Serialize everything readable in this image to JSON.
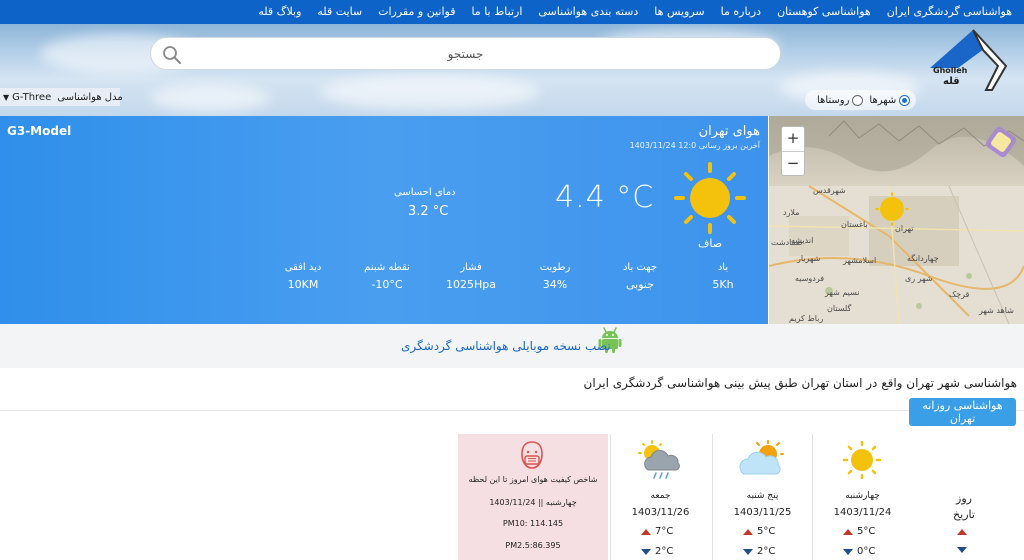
{
  "nav": {
    "items": [
      "هواشناسی گردشگری ایران",
      "هواشناسی کوهستان",
      "درباره ما",
      "سرویس ها",
      "دسته بندی هواشناسی",
      "ارتباط با ما",
      "قوانین و مقررات",
      "سایت قله",
      "وبلاگ قله"
    ]
  },
  "header": {
    "search_placeholder": "جستجو",
    "logo_text": "Gholleh",
    "logo_text_fa": "قله",
    "radio_cities": "شهرها",
    "radio_villages": "روستاها",
    "model_label": "مدل هواشناسی",
    "model_value": "G-Three"
  },
  "weather": {
    "model_name": "G3-Model",
    "city_title": "هوای تهران",
    "updated": "آخرین بروز رسانی 12:0 1403/11/24",
    "temperature": "4.4 °C",
    "condition": "صاف",
    "feels_label": "دمای احساسی",
    "feels_value": "3.2 °C",
    "stats": [
      {
        "label": "باد",
        "value": "5Kh"
      },
      {
        "label": "جهت باد",
        "value": "جنوبی"
      },
      {
        "label": "رطوبت",
        "value": "34%"
      },
      {
        "label": "فشار",
        "value": "1025Hpa"
      },
      {
        "label": "نقطه شبنم",
        "value": "-10°C"
      },
      {
        "label": "دید افقی",
        "value": "10KM"
      }
    ]
  },
  "map": {
    "zoom_in": "+",
    "zoom_out": "−",
    "labels": [
      "شهرقدس",
      "ملارد",
      "باغستان",
      "اندیشه",
      "شهریار",
      "صفادشت",
      "اسلامشهر",
      "تهران",
      "چهاردانگه",
      "شهر ری",
      "فردوسیه",
      "قرچک",
      "نسیم شهر",
      "گلستان",
      "رباط کریم",
      "شاهد شهر"
    ]
  },
  "app": {
    "install_text": "نصب نسخه موبایلی هواشناسی گردشگری"
  },
  "description": "هواشناسی شهر تهران واقع در استان تهران طبق پیش بینی هواشناسی گردشگری ایران",
  "daily_button": "هواشناسی روزانه تهران",
  "forecast": {
    "row_day": "روز",
    "row_date": "تاریخ",
    "days": [
      {
        "day": "چهارشنبه",
        "date": "1403/11/24",
        "hi": "5°C",
        "lo": "0°C",
        "icon": "sun-icon"
      },
      {
        "day": "پنج شنبه",
        "date": "1403/11/25",
        "hi": "5°C",
        "lo": "2°C",
        "icon": "sun-cloud-icon"
      },
      {
        "day": "جمعه",
        "date": "1403/11/26",
        "hi": "7°C",
        "lo": "2°C",
        "icon": "rain-cloud-icon"
      }
    ],
    "air_quality": {
      "title": "شاخص کیفیت هوای امروز تا این لحظه",
      "date": "چهارشنبه || 1403/11/24",
      "pm10": "PM10: 114.145",
      "pm25": "PM2.5:86.395"
    }
  },
  "colors": {
    "nav_bg": "#0d63c7",
    "weather_bg": "#3d93ec",
    "accent_button": "#3a9fe6",
    "air_quality_bg": "#f6dfe3",
    "sun": "#f4c20d"
  }
}
